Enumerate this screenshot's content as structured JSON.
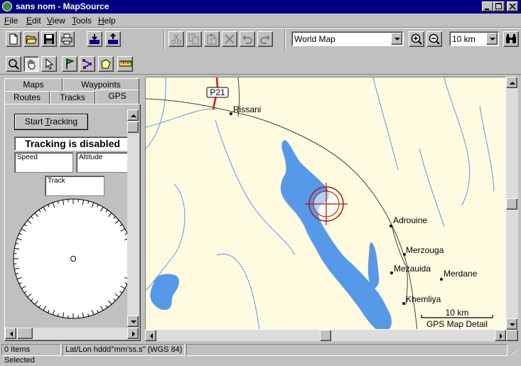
{
  "window": {
    "title": "sans nom - MapSource"
  },
  "menu": [
    {
      "label": "File",
      "underline": "F",
      "rest": "ile"
    },
    {
      "label": "Edit",
      "underline": "E",
      "rest": "dit"
    },
    {
      "label": "View",
      "underline": "V",
      "rest": "iew"
    },
    {
      "label": "Tools",
      "underline": "T",
      "rest": "ools"
    },
    {
      "label": "Help",
      "underline": "H",
      "rest": "elp"
    }
  ],
  "toolbar": {
    "map_product": "World Map",
    "zoom_scale": "10 km"
  },
  "left_panel": {
    "tabs_back": [
      "Maps",
      "Waypoints"
    ],
    "tabs_front": [
      "Routes",
      "Tracks",
      "GPS"
    ],
    "active_tab": "GPS",
    "start_tracking_label": "Start Tracking",
    "start_tracking_underline": "T",
    "tracking_status": "Tracking is disabled",
    "speed_label": "Speed",
    "altitude_label": "Altitude",
    "track_label": "Track"
  },
  "map": {
    "road_label": "P21",
    "places": [
      "Rissani",
      "Adrouine",
      "Merzouga",
      "Mezauida",
      "Merdane",
      "Khemliya"
    ],
    "scale_label": "10 km",
    "detail_label": "GPS Map Detail",
    "colors": {
      "land": "#fffbe1",
      "water": "#5599e8",
      "road": "#e01010",
      "track": "#404040"
    }
  },
  "status": {
    "selection": "0 Items Selected",
    "coord_format": "Lat/Lon hddd°mm'ss.s\" (WGS 84)"
  }
}
